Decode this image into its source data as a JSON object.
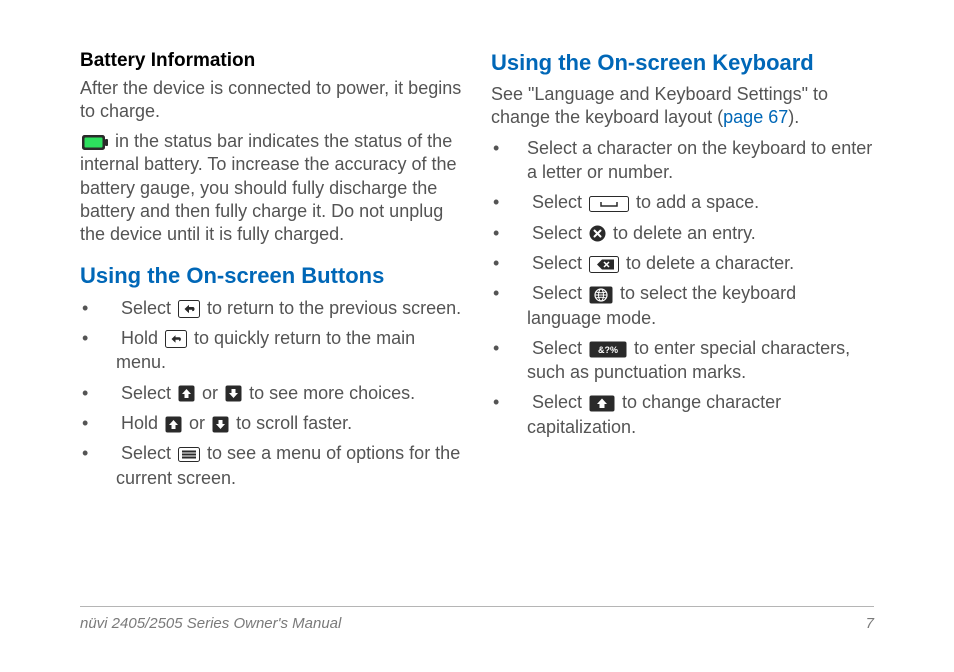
{
  "col1": {
    "battery": {
      "heading": "Battery Information",
      "p1": "After the device is connected to power, it begins to charge.",
      "p2_before": "",
      "p2_after": " in the status bar indicates the status of the internal battery. To increase the accuracy of the battery gauge, you should fully discharge the battery and then fully charge it. Do not unplug the device until it is fully charged."
    },
    "buttons": {
      "heading": "Using the On-screen Buttons",
      "b1_a": "Select ",
      "b1_b": " to return to the previous screen.",
      "b2_a": "Hold ",
      "b2_b": " to quickly return to the main menu.",
      "b3_a": "Select ",
      "b3_mid": " or ",
      "b3_b": " to see more choices.",
      "b4_a": "Hold ",
      "b4_mid": " or ",
      "b4_b": " to scroll faster.",
      "b5_a": "Select ",
      "b5_b": " to see a menu of options for the current screen."
    }
  },
  "col2": {
    "keyboard": {
      "heading": "Using the On-screen Keyboard",
      "intro_a": "See \"Language and Keyboard Settings\" to change the keyboard layout (",
      "intro_link": "page 67",
      "intro_b": ").",
      "k1": "Select a character on the keyboard to enter a letter or number.",
      "k2_a": "Select ",
      "k2_b": " to add a space.",
      "k3_a": "Select ",
      "k3_b": " to delete an entry.",
      "k4_a": "Select ",
      "k4_b": " to delete a character.",
      "k5_a": "Select ",
      "k5_b": " to select the keyboard language mode.",
      "k6_a": "Select ",
      "k6_b": " to enter special characters, such as punctuation marks.",
      "k7_a": "Select ",
      "k7_b": " to change character capitalization."
    }
  },
  "footer": {
    "left": "nüvi 2405/2505 Series Owner's Manual",
    "right": "7"
  }
}
